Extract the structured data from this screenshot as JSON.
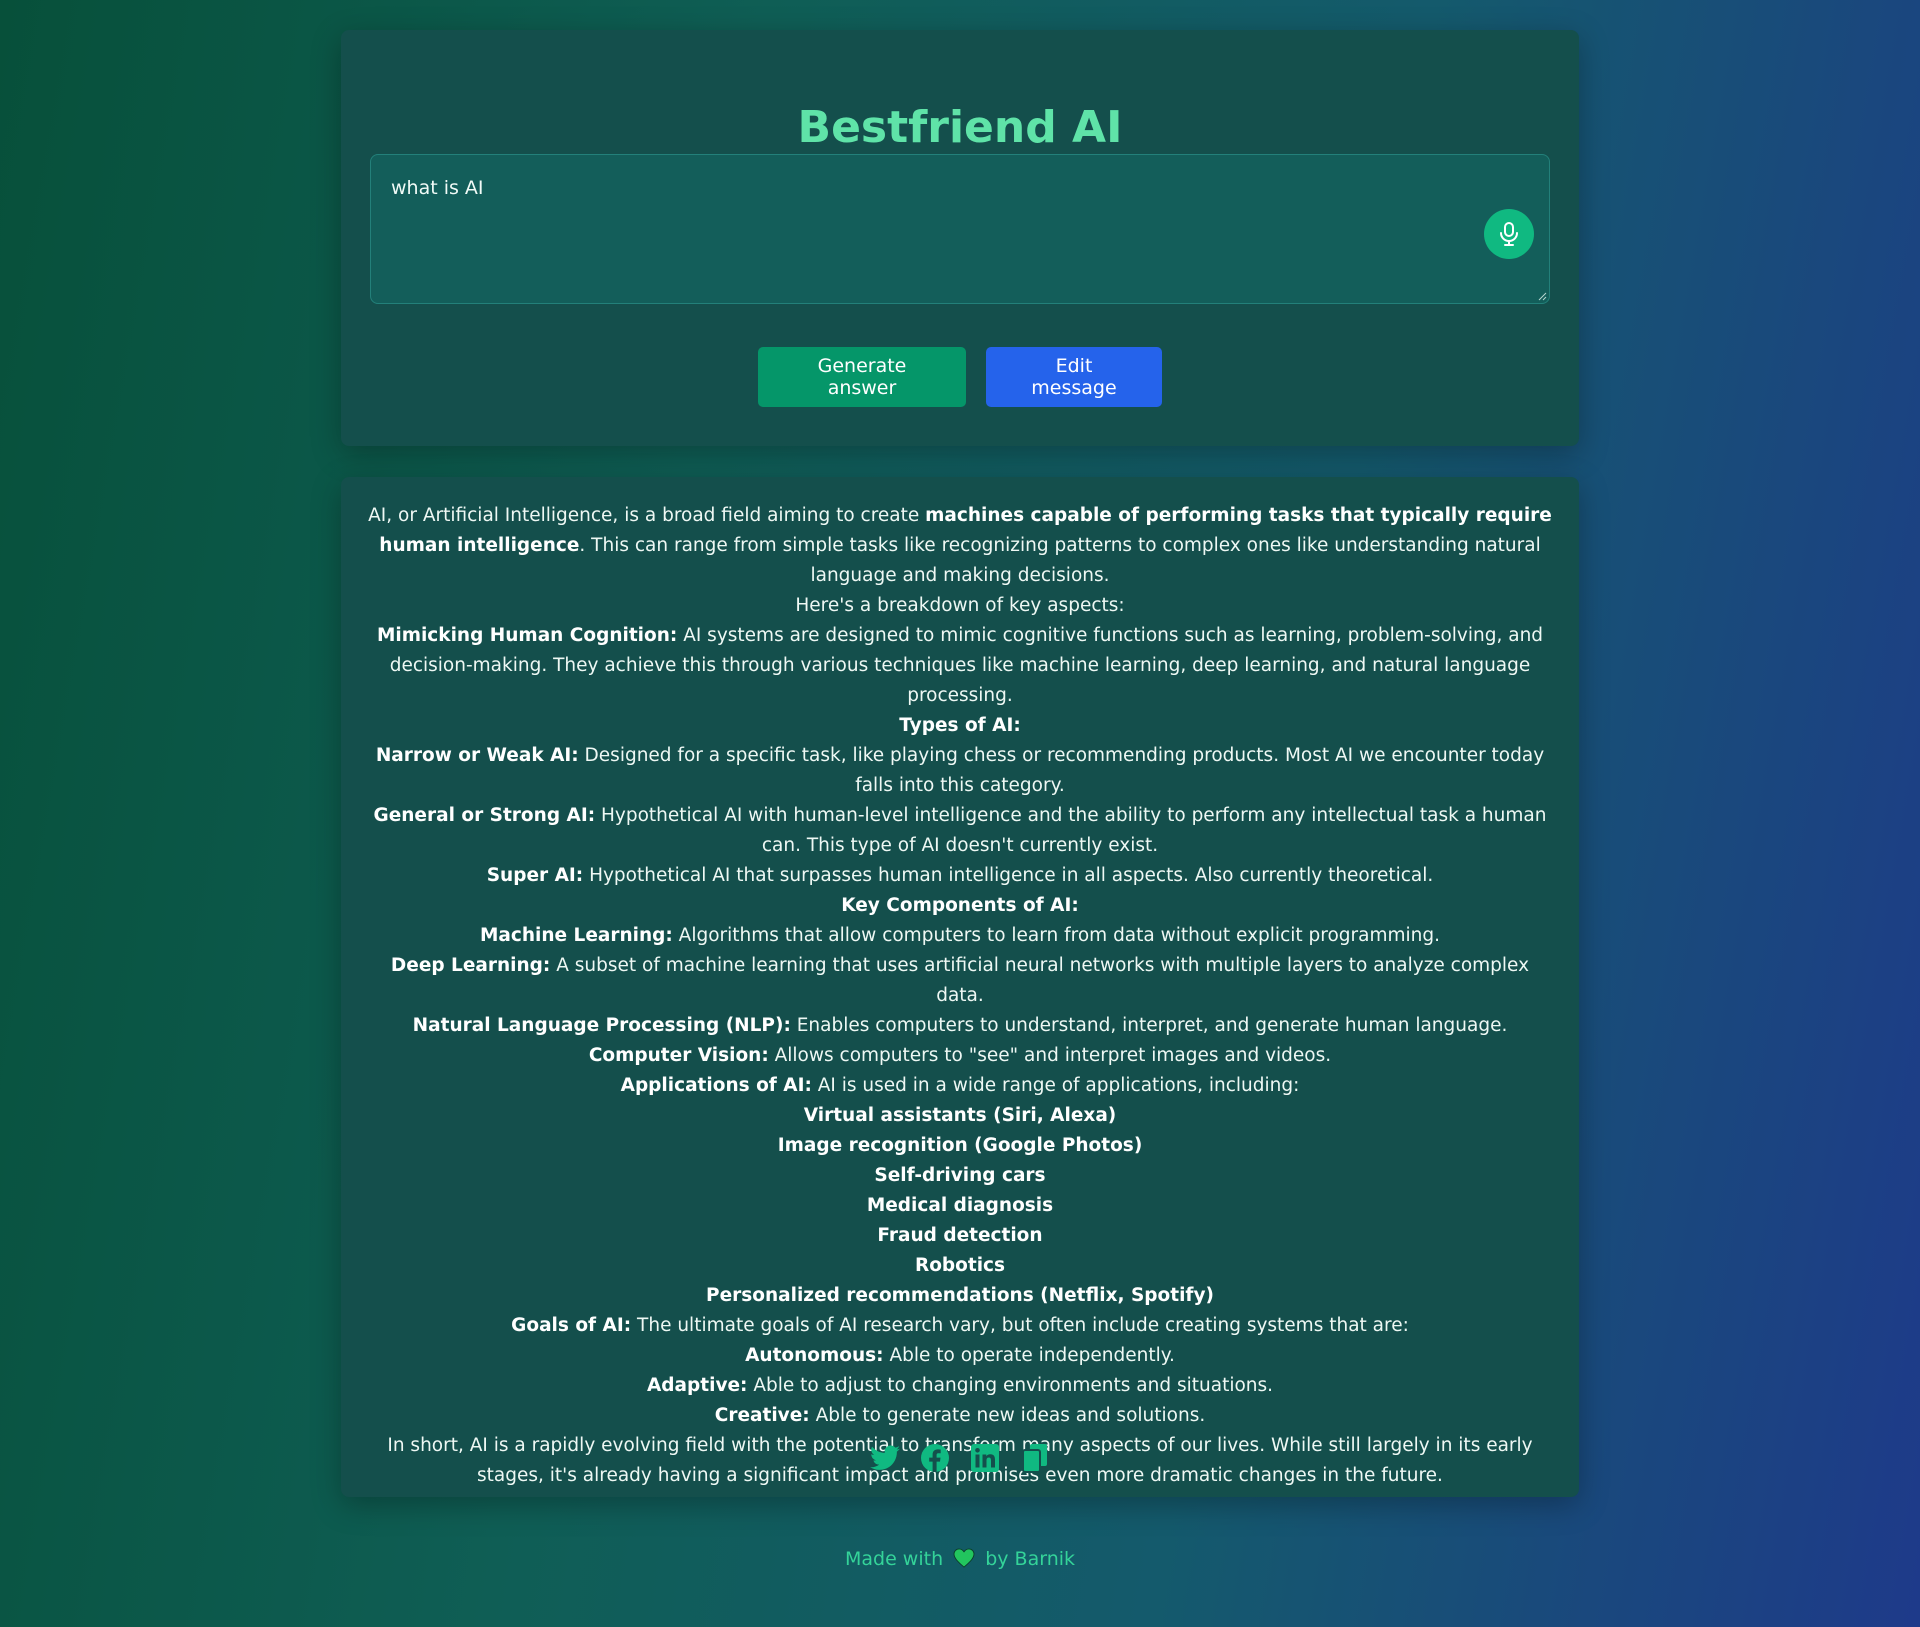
{
  "app": {
    "title": "Bestfriend AI"
  },
  "input": {
    "value": "what is AI"
  },
  "buttons": {
    "generate_label": "Generate answer",
    "edit_label": "Edit message"
  },
  "answer": {
    "intro": {
      "prefix": "AI, or Artificial Intelligence, is a broad field aiming to create ",
      "bold": "machines capable of performing tasks that typically require human intelligence",
      "suffix": ". This can range from simple tasks like recognizing patterns to complex ones like understanding natural language and making decisions."
    },
    "breakdown": "Here's a breakdown of key aspects:",
    "mimicking": {
      "label": "Mimicking Human Cognition:",
      "text": " AI systems are designed to mimic cognitive functions such as learning, problem-solving, and decision-making. They achieve this through various techniques like machine learning, deep learning, and natural language processing."
    },
    "types_heading": "Types of AI:",
    "narrow": {
      "label": "Narrow or Weak AI:",
      "text": " Designed for a specific task, like playing chess or recommending products. Most AI we encounter today falls into this category."
    },
    "general": {
      "label": "General or Strong AI:",
      "text": " Hypothetical AI with human-level intelligence and the ability to perform any intellectual task a human can. This type of AI doesn't currently exist."
    },
    "super": {
      "label": "Super AI:",
      "text": " Hypothetical AI that surpasses human intelligence in all aspects. Also currently theoretical."
    },
    "components_heading": "Key Components of AI:",
    "ml": {
      "label": "Machine Learning:",
      "text": " Algorithms that allow computers to learn from data without explicit programming."
    },
    "dl": {
      "label": "Deep Learning:",
      "text": " A subset of machine learning that uses artificial neural networks with multiple layers to analyze complex data."
    },
    "nlp": {
      "label": "Natural Language Processing (NLP):",
      "text": " Enables computers to understand, interpret, and generate human language."
    },
    "cv": {
      "label": "Computer Vision:",
      "text": " Allows computers to \"see\" and interpret images and videos."
    },
    "applications": {
      "label": "Applications of AI:",
      "text": " AI is used in a wide range of applications, including:"
    },
    "app_items": [
      "Virtual assistants (Siri, Alexa)",
      "Image recognition (Google Photos)",
      "Self-driving cars",
      "Medical diagnosis",
      "Fraud detection",
      "Robotics",
      "Personalized recommendations (Netflix, Spotify)"
    ],
    "goals": {
      "label": "Goals of AI:",
      "text": " The ultimate goals of AI research vary, but often include creating systems that are:"
    },
    "autonomous": {
      "label": "Autonomous:",
      "text": " Able to operate independently."
    },
    "adaptive": {
      "label": "Adaptive:",
      "text": " Able to adjust to changing environments and situations."
    },
    "creative": {
      "label": "Creative:",
      "text": " Able to generate new ideas and solutions."
    },
    "conclusion": "In short, AI is a rapidly evolving field with the potential to transform many aspects of our lives. While still largely in its early stages, it's already having a significant impact and promises even more dramatic changes in the future."
  },
  "share_icons": [
    "twitter-icon",
    "facebook-icon",
    "linkedin-icon",
    "copy-icon"
  ],
  "footer": {
    "prefix": "Made with",
    "suffix": "by Barnik"
  },
  "colors": {
    "title": "#5fe3a8",
    "generate_button": "#059669",
    "edit_button": "#2563eb",
    "mic_button": "#10b981",
    "icon_accent": "#10b981",
    "heart": "#22c55e"
  }
}
